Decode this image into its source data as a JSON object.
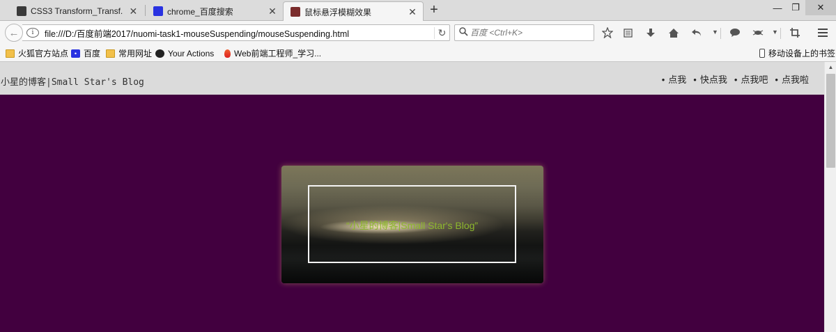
{
  "browser": {
    "tabs": [
      {
        "title": "CSS3 Transform_Transf...",
        "icon": "css-site-favicon",
        "color": "#3a3a3a"
      },
      {
        "title": "chrome_百度搜索",
        "icon": "baidu-paw-favicon",
        "color": "#2932e1"
      },
      {
        "title": "鼠标悬浮模糊效果",
        "icon": "page-favicon",
        "color": "#7a2c2c"
      }
    ],
    "new_tab_label": "+",
    "window_controls": {
      "minimize": "—",
      "restore": "❐",
      "close": "✕"
    }
  },
  "navbar": {
    "back_label": "←",
    "url": "file:///D:/百度前端2017/nuomi-task1-mouseSuspending/mouseSuspending.html",
    "reload_label": "↻",
    "search_placeholder": "百度 <Ctrl+K>",
    "tools": [
      "star-icon",
      "reading-list-icon",
      "download-icon",
      "home-icon",
      "history-back-icon",
      "chat-icon",
      "extension-icon",
      "crop-icon",
      "menu-icon"
    ]
  },
  "bookmarks": [
    {
      "label": "火狐官方站点",
      "icon": "folder-icon"
    },
    {
      "label": "百度",
      "icon": "baidu-icon"
    },
    {
      "label": "常用网址",
      "icon": "folder-icon"
    },
    {
      "label": "Your Actions",
      "icon": "github-icon"
    },
    {
      "label": "Web前端工程师_学习...",
      "icon": "flame-icon"
    }
  ],
  "mobile_bookmarks_label": "移动设备上的书签",
  "page": {
    "site_title": "小星的博客|Small Star's Blog",
    "nav": [
      "点我",
      "快点我",
      "点我吧",
      "点我啦"
    ],
    "card_caption": "“小星的博客|Small Star's Blog”",
    "background_color": "#42003f",
    "caption_color": "#8cb72d"
  }
}
